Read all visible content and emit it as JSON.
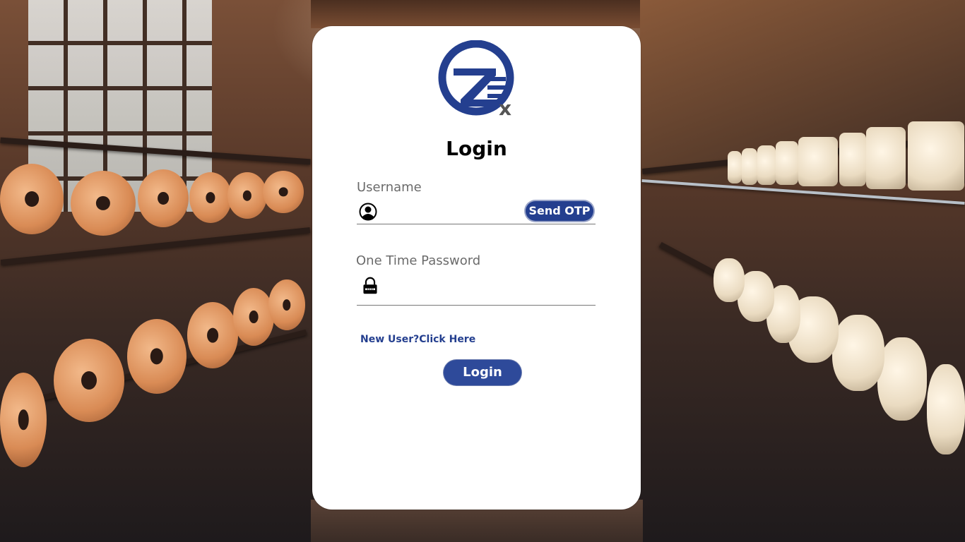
{
  "page": {
    "title": "Login"
  },
  "logo": {
    "alt": "TZx logo"
  },
  "username": {
    "label": "Username",
    "value": "",
    "send_otp_label": "Send OTP"
  },
  "otp": {
    "label": "One Time Password",
    "value": ""
  },
  "links": {
    "new_user": "New User?Click Here"
  },
  "actions": {
    "login_label": "Login"
  },
  "colors": {
    "brand_blue": "#243f8f",
    "button_blue": "#2e4a9a",
    "card": "#ffffff"
  },
  "icons": {
    "username": "user-circle-icon",
    "otp": "lock-icon"
  }
}
